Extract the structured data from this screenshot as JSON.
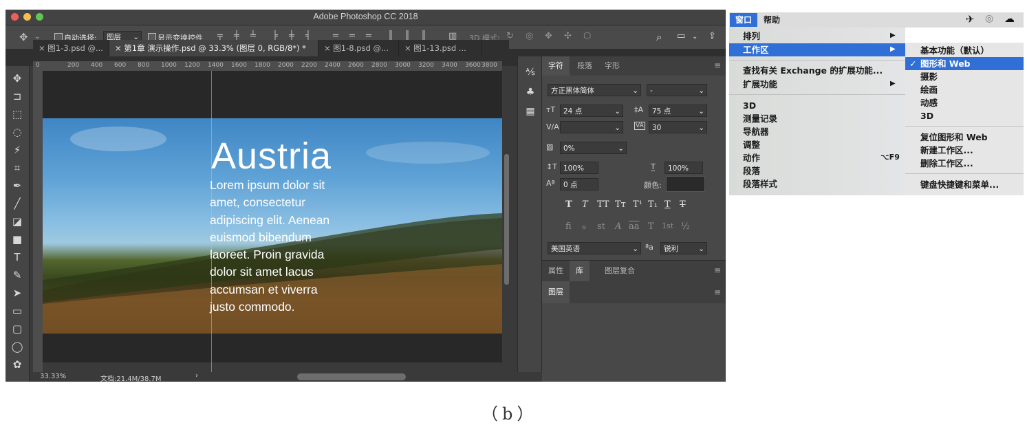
{
  "window": {
    "title": "Adobe Photoshop CC 2018",
    "traffic_colors": [
      "#ee5f5b",
      "#f5bf4f",
      "#61c554"
    ]
  },
  "options_bar": {
    "auto_select_label": "自动选择:",
    "auto_select_value": "图层",
    "show_transform_label": "显示变换控件",
    "mode_3d_label": "3D 模式:"
  },
  "tabs": [
    {
      "label": "× 图1-3.psd @..."
    },
    {
      "label": "× 第1章 演示操作.psd @ 33.3% (图层 0, RGB/8*) *"
    },
    {
      "label": "× 图1-8.psd @..."
    },
    {
      "label": "× 图1-13.psd ..."
    }
  ],
  "ruler": {
    "top_ticks": [
      "0",
      "200",
      "400",
      "600",
      "800",
      "1000",
      "1200",
      "1400",
      "1600",
      "1800",
      "2000",
      "2200",
      "2400",
      "2600",
      "2800",
      "3000",
      "3200",
      "3400",
      "3600",
      "3800"
    ]
  },
  "document": {
    "title": "Austria",
    "body_lines": [
      "Lorem ipsum dolor sit",
      "amet, consectetur",
      "adipiscing elit. Aenean",
      "euismod bibendum",
      "laoreet. Proin gravida",
      "dolor sit amet lacus",
      "accumsan et viverra",
      "justo commodo."
    ]
  },
  "status": {
    "zoom": "33.33%",
    "doc_size": "文档:21.4M/38.7M",
    "arrow": "›"
  },
  "character_panel": {
    "tabs": [
      "字符",
      "段落",
      "字形"
    ],
    "font_family": "方正黑体简体",
    "font_style": "-",
    "font_size": "24 点",
    "leading": "75 点",
    "kerning": "",
    "tracking": "30",
    "tsume": "0%",
    "vertical_scale": "100%",
    "horizontal_scale": "100%",
    "baseline_shift": "0 点",
    "color_label": "颜色:",
    "style_glyphs": [
      "T",
      "T",
      "TT",
      "Tт",
      "T¹",
      "T₁",
      "T",
      "T"
    ],
    "opentype_glyphs": [
      "fi",
      "ℴ",
      "st",
      "A",
      "aa",
      "T",
      "1st",
      "½"
    ],
    "language": "美国英语",
    "aa_label": "ªa",
    "antialias": "锐利"
  },
  "properties_panel": {
    "tabs": [
      "属性",
      "库",
      "图层复合"
    ]
  },
  "layers_panel": {
    "tabs": [
      "图层"
    ]
  },
  "menu_bar": {
    "window": "窗口",
    "help": "帮助"
  },
  "window_menu": {
    "items": [
      {
        "label": "排列",
        "arrow": "▶"
      },
      {
        "label": "工作区",
        "arrow": "▶"
      },
      {
        "label": "查找有关 Exchange 的扩展功能..."
      },
      {
        "label": "扩展功能",
        "arrow": "▶"
      },
      {
        "label": "3D"
      },
      {
        "label": "测量记录"
      },
      {
        "label": "导航器"
      },
      {
        "label": "调整"
      },
      {
        "label": "动作",
        "shortcut": "⌥F9"
      },
      {
        "label": "段落"
      },
      {
        "label": "段落样式"
      }
    ]
  },
  "workspace_submenu": {
    "items": [
      {
        "label": "基本功能（默认）"
      },
      {
        "label": "图形和 Web",
        "check": "✓"
      },
      {
        "label": "摄影"
      },
      {
        "label": "绘画"
      },
      {
        "label": "动感"
      },
      {
        "label": "3D"
      },
      {
        "label": "复位图形和 Web"
      },
      {
        "label": "新建工作区..."
      },
      {
        "label": "删除工作区..."
      },
      {
        "label": "键盘快捷键和菜单..."
      }
    ]
  },
  "caption": "（b）"
}
